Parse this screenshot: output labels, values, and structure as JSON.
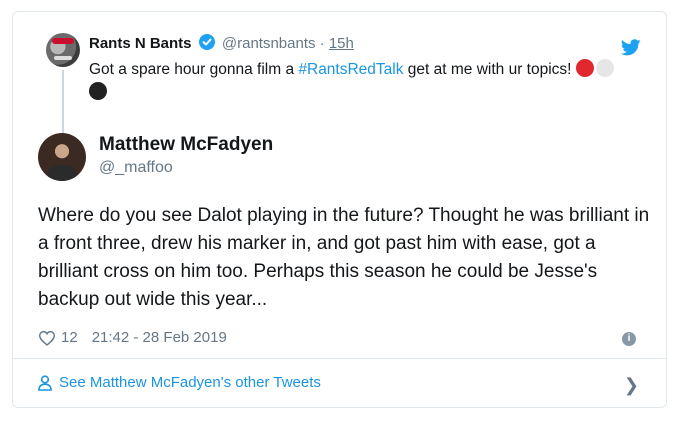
{
  "parent_tweet": {
    "name": "Rants N Bants",
    "handle": "@rantsnbants",
    "separator": "·",
    "time": "15h",
    "text_before": "Got a spare hour gonna film a ",
    "hashtag": "#RantsRedTalk",
    "text_after": " get at me with ur topics! ",
    "dot_colors": [
      "#e0282e",
      "#e6e6e6",
      "#222222"
    ]
  },
  "main_tweet": {
    "name": "Matthew McFadyen",
    "handle": "@_maffoo",
    "text": "Where do you see Dalot playing in the future?  Thought he was brilliant in a front three, drew his marker in, and got past him with ease, got a brilliant cross on him too.  Perhaps this season he could be Jesse's backup out wide this year...",
    "likes": "12",
    "timestamp": "21:42 - 28 Feb 2019"
  },
  "footer": {
    "link_label": "See Matthew McFadyen's other Tweets"
  },
  "colors": {
    "accent": "#1b95e0",
    "muted": "#657786",
    "border": "#e1e8ed"
  }
}
